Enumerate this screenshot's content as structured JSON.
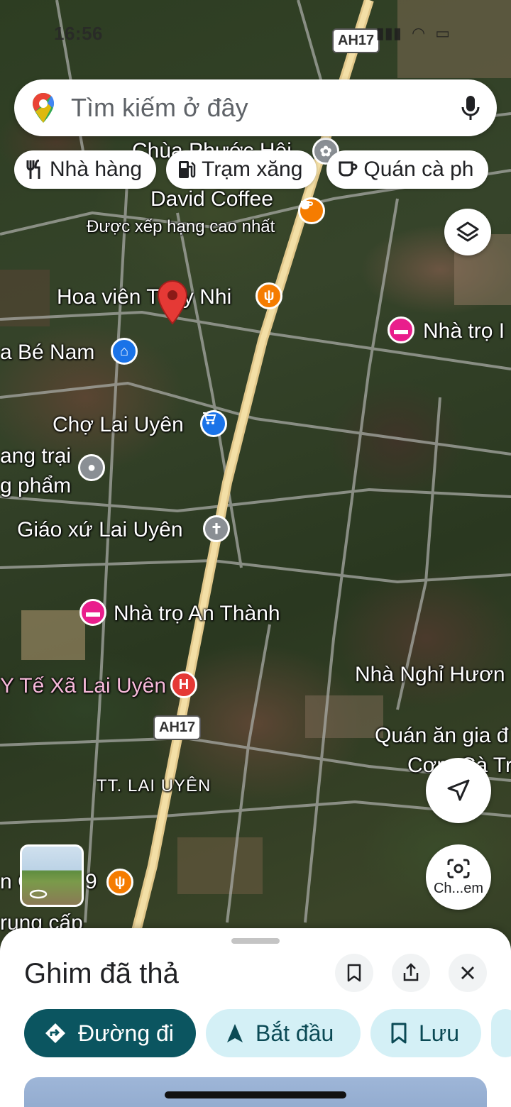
{
  "status_bar": {
    "time": "16:56",
    "signal": "signal-icon",
    "wifi": "wifi-icon",
    "battery": "battery-icon"
  },
  "search": {
    "placeholder": "Tìm kiếm ở đây"
  },
  "chips": [
    {
      "label": "Nhà hàng",
      "icon": "utensils-icon"
    },
    {
      "label": "Trạm xăng",
      "icon": "gas-station-icon"
    },
    {
      "label": "Quán cà ph",
      "icon": "coffee-icon"
    }
  ],
  "map": {
    "labels": {
      "chua": "Chùa Phước Hội",
      "david": "David Coffee",
      "david_sub": "Được xếp hạng cao nhất",
      "hoavien": "Hoa viên Thụy Nhi",
      "banam": "a Bé Nam",
      "nhatro1": "Nhà trọ I",
      "cho": "Chợ Lai Uyên",
      "trangtrai1": "ang trại",
      "trangtrai2": "g phẩm",
      "giaoxu": "Giáo xứ Lai Uyên",
      "anthanh": "Nhà trọ An Thành",
      "ytexa": "Y Tế Xã Lai Uyên",
      "nhanghi": "Nhà Nghỉ Hươn",
      "quanan1": "Quán ăn gia đ",
      "quanan2": "Cơm Cà Tr",
      "town": "TT. LAI UYÊN",
      "trungcap": "rung cấp",
      "bottom_left": "n C",
      "bottom_nine": "9"
    },
    "road_shield_top": "AH17",
    "road_shield": "AH17",
    "lens_button": "Ch...em"
  },
  "sheet": {
    "title": "Ghim đã thả",
    "actions": [
      {
        "label": "Đường đi",
        "icon": "directions-icon"
      },
      {
        "label": "Bắt đầu",
        "icon": "navigation-arrow-icon"
      },
      {
        "label": "Lưu",
        "icon": "bookmark-icon"
      }
    ]
  },
  "colors": {
    "accent_primary": "#0b5560",
    "accent_secondary": "#d4f0f6",
    "pin_red": "#e53935",
    "poi_orange": "#f57c00",
    "poi_blue": "#1a73e8",
    "poi_pink": "#e91e8c",
    "poi_gray": "#8a8f94"
  }
}
